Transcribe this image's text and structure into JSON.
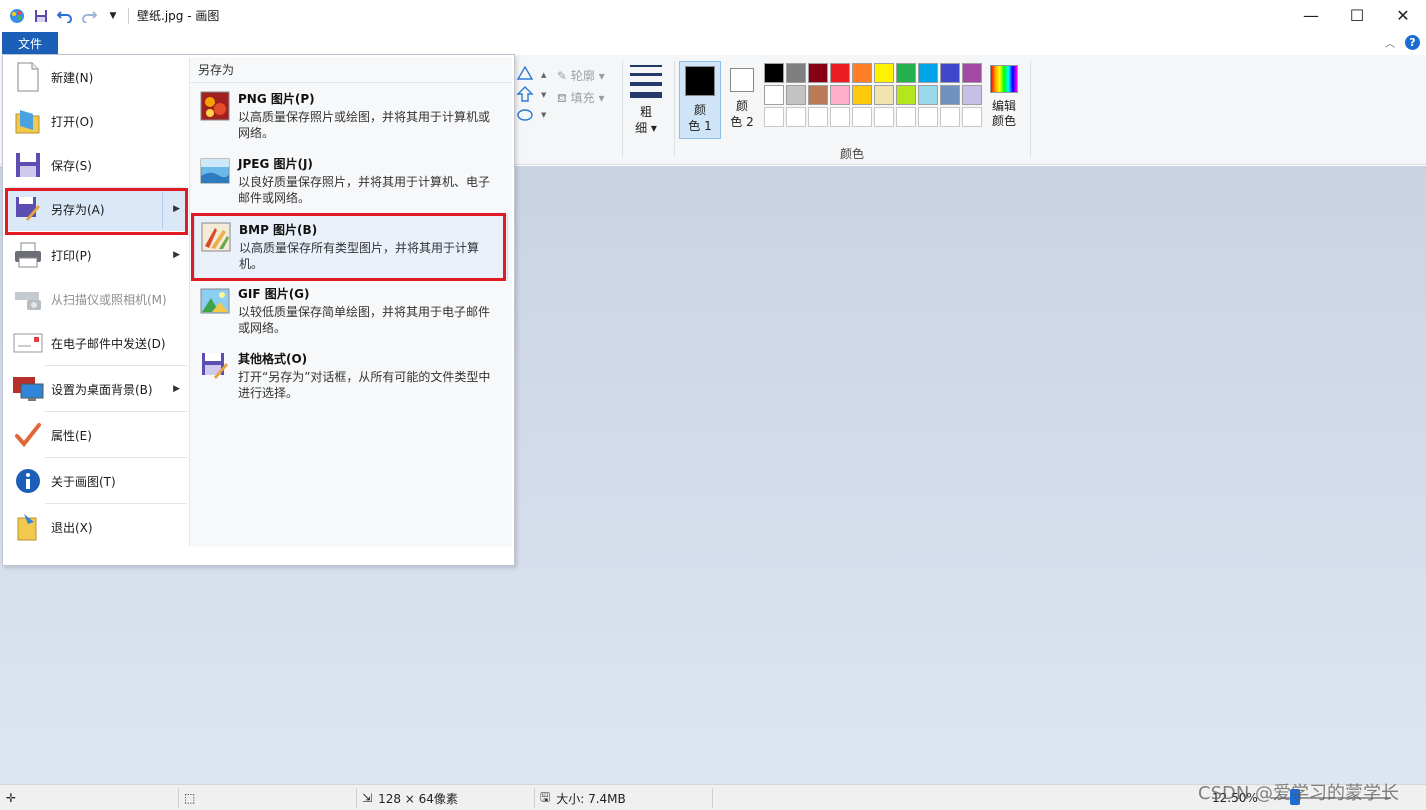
{
  "window": {
    "title": "壁纸.jpg - 画图",
    "minimize": "—",
    "maximize": "☐",
    "close": "✕"
  },
  "ribbon": {
    "file_tab": "文件",
    "outline": "轮廓",
    "fill": "填充",
    "size_label": "粗\n细",
    "size_top": "粗",
    "size_bottom": "细",
    "color1_top": "颜",
    "color1_bottom": "色 1",
    "color2_top": "颜",
    "color2_bottom": "色 2",
    "edit_colors_top": "编辑",
    "edit_colors_bottom": "颜色",
    "colors_group": "颜色",
    "color1_value": "#000000",
    "color2_value": "#ffffff",
    "palette": [
      "#000000",
      "#7f7f7f",
      "#880015",
      "#ed1c24",
      "#ff7f27",
      "#fff200",
      "#22b14c",
      "#00a2e8",
      "#3f48cc",
      "#a349a4",
      "#ffffff",
      "#c3c3c3",
      "#b97a57",
      "#ffaec9",
      "#ffc90e",
      "#efe4b0",
      "#b5e61d",
      "#99d9ea",
      "#7092be",
      "#c8bfe7"
    ]
  },
  "file_menu": {
    "items": [
      {
        "label": "新建(N)",
        "icon": "new-file-icon"
      },
      {
        "label": "打开(O)",
        "icon": "open-folder-icon"
      },
      {
        "label": "保存(S)",
        "icon": "save-disk-icon"
      },
      {
        "label": "另存为(A)",
        "icon": "save-as-icon"
      },
      {
        "label": "打印(P)",
        "icon": "printer-icon"
      },
      {
        "label": "从扫描仪或照相机(M)",
        "icon": "scanner-icon"
      },
      {
        "label": "在电子邮件中发送(D)",
        "icon": "email-icon"
      },
      {
        "label": "设置为桌面背景(B)",
        "icon": "desktop-background-icon"
      },
      {
        "label": "属性(E)",
        "icon": "properties-check-icon"
      },
      {
        "label": "关于画图(T)",
        "icon": "info-icon"
      },
      {
        "label": "退出(X)",
        "icon": "exit-icon"
      }
    ],
    "submenu_title": "另存为",
    "save_as_options": [
      {
        "title": "PNG 图片(P)",
        "desc": "以高质量保存照片或绘图，并将其用于计算机或网络。",
        "icon": "png-image-icon"
      },
      {
        "title": "JPEG 图片(J)",
        "desc": "以良好质量保存照片，并将其用于计算机、电子邮件或网络。",
        "icon": "jpeg-image-icon"
      },
      {
        "title": "BMP 图片(B)",
        "desc": "以高质量保存所有类型图片，并将其用于计算机。",
        "icon": "bmp-image-icon"
      },
      {
        "title": "GIF 图片(G)",
        "desc": "以较低质量保存简单绘图，并将其用于电子邮件或网络。",
        "icon": "gif-image-icon"
      },
      {
        "title": "其他格式(O)",
        "desc": "打开“另存为”对话框，从所有可能的文件类型中进行选择。",
        "icon": "other-formats-icon"
      }
    ]
  },
  "statusbar": {
    "dimensions": "128 × 64像素",
    "size": "大小: 7.4MB",
    "zoom": "12.50%",
    "watermark": "CSDN @爱学习的蒙学长"
  }
}
